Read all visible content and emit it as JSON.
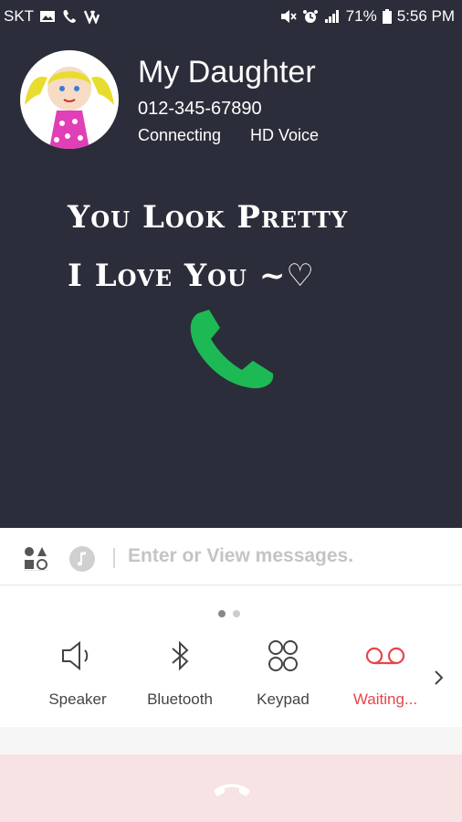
{
  "status_bar": {
    "carrier": "SKT",
    "battery": "71%",
    "time": "5:56 PM"
  },
  "caller": {
    "name": "My Daughter",
    "number": "012-345-67890",
    "call_status": "Connecting",
    "voice_quality": "HD Voice"
  },
  "message": {
    "line1": "You Look Pretty",
    "line2": "I Love You ~♡"
  },
  "message_bar": {
    "placeholder": "Enter or View messages."
  },
  "controls": [
    {
      "label": "Speaker",
      "icon": "speaker-icon"
    },
    {
      "label": "Bluetooth",
      "icon": "bluetooth-icon"
    },
    {
      "label": "Keypad",
      "icon": "keypad-icon"
    },
    {
      "label": "Waiting...",
      "icon": "voicemail-icon"
    }
  ],
  "colors": {
    "background_top": "#2b2d3a",
    "call_green": "#1db954",
    "accent_red": "#e6454a",
    "end_call_bar": "#f7e3e3"
  },
  "pager": {
    "current": 1,
    "total": 2
  }
}
